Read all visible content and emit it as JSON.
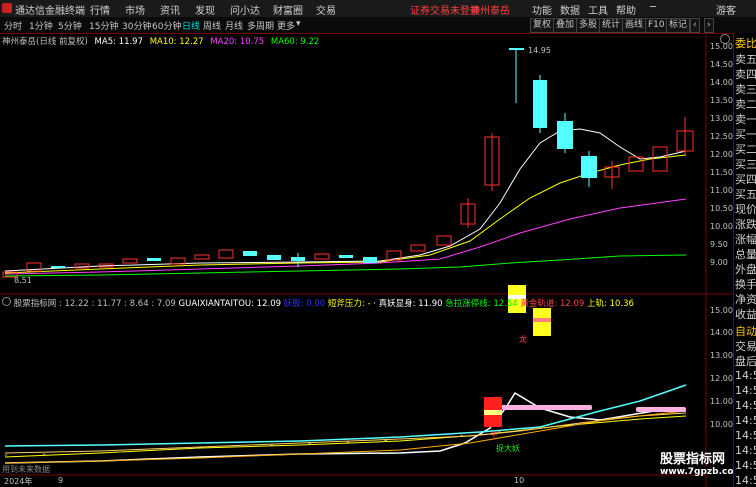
{
  "app": {
    "title": "通达信金融终端",
    "menu": [
      "行情",
      "市场",
      "资讯",
      "发现",
      "问小达",
      "财富圈",
      "交易"
    ],
    "notice": "证券交易未登录",
    "stock_name": "神州泰岳",
    "right_menu": [
      "功能",
      "数据",
      "工具",
      "帮助"
    ],
    "guest": "游客"
  },
  "toolbar": {
    "periods": [
      "分时",
      "1分钟",
      "5分钟",
      "15分钟",
      "30分钟",
      "60分钟",
      "日线",
      "周线",
      "月线",
      "多周期",
      "更多"
    ],
    "active": "日线",
    "buttons": [
      "复权",
      "叠加",
      "多股",
      "统计",
      "画线",
      "F10",
      "标记"
    ],
    "more_arrow": "▾"
  },
  "main_info": {
    "title": "神州泰岳(日线 前复权)",
    "ma5": "MA5: 11.97",
    "ma10": "MA10: 12.27",
    "ma20": "MA20: 10.75",
    "ma60": "MA60: 9.22",
    "high_label": "14.95",
    "low_label": "8.51"
  },
  "indicator_info": {
    "name": "股票指标网",
    "values": ": 12.22 : 11.77 : 8.64 : 7.09",
    "item_a": "GUAIXIANTAITOU: 12.09",
    "item_b": "妖股: 0.00",
    "item_c": "短斧压力: -",
    "item_d": "· 真妖显身: 11.90",
    "item_e": "急拉涨停线: 12.54",
    "item_f": "黄金轨道: 12.09",
    "item_g": "上轨: 10.36",
    "label_long": "龙",
    "label_catch": "捉大妖",
    "label_gan": "干"
  },
  "right_panel": [
    "委比",
    "卖五",
    "卖四",
    "卖三",
    "卖二",
    "卖一",
    "买一",
    "买二",
    "买三",
    "买四",
    "买五",
    "现价",
    "涨跌",
    "涨幅",
    "总量",
    "外盘",
    "换手",
    "净资",
    "收益",
    "自动",
    "交易",
    "盘后",
    "14:5",
    "14:5",
    "14:5",
    "14:5",
    "14:5",
    "14:5",
    "14:5",
    "14:5"
  ],
  "axis_main": [
    "15.00",
    "14.50",
    "14.00",
    "13.50",
    "13.00",
    "12.50",
    "12.00",
    "11.50",
    "11.00",
    "10.50",
    "10.00",
    "9.50",
    "9.00"
  ],
  "axis_ind": [
    "15.00",
    "14.00",
    "13.00",
    "12.00",
    "11.00",
    "10.00"
  ],
  "bottom": {
    "year": "2024年",
    "mark1": "9",
    "mark2": "10",
    "note": "用到未来数据",
    "watermark_cn": "股票指标网",
    "watermark_url": "www.7gpzb.com"
  },
  "colors": {
    "up": "#ff3030",
    "down": "#54ffff",
    "ma5": "#ffffff",
    "ma10": "#ffff00",
    "ma20": "#ff40ff",
    "ma60": "#00ff00"
  }
}
